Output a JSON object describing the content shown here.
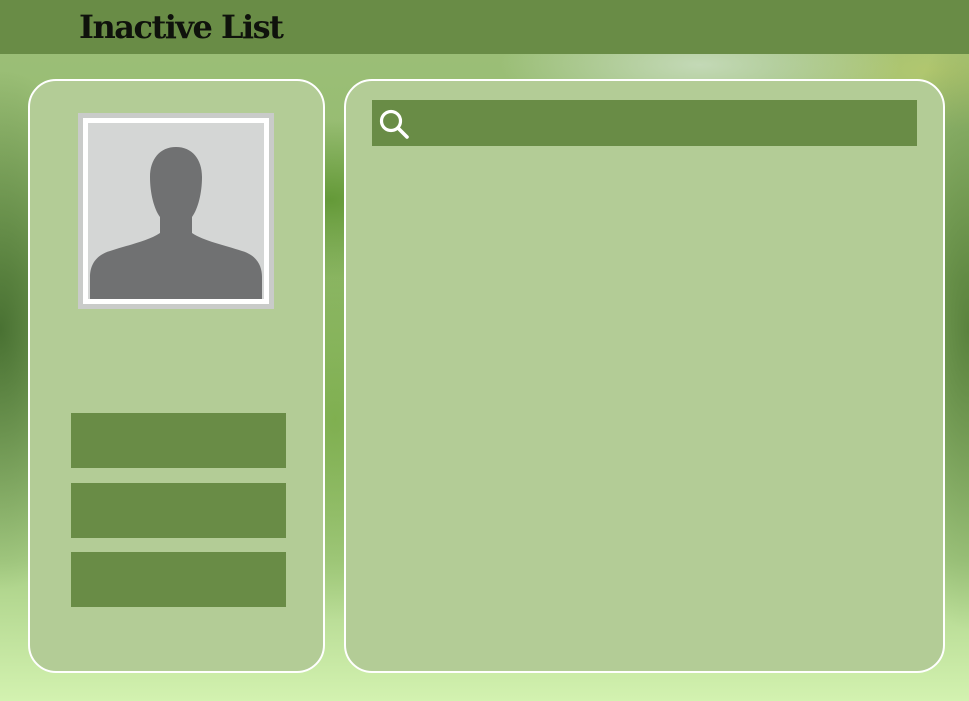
{
  "header": {
    "title": "Inactive List"
  },
  "profile": {
    "avatar_icon": "default-user-silhouette-icon"
  },
  "sidebar": {
    "buttons": [
      {
        "label": ""
      },
      {
        "label": ""
      },
      {
        "label": ""
      }
    ]
  },
  "search": {
    "icon": "search-icon",
    "value": "",
    "placeholder": ""
  },
  "colors": {
    "header_bar": "#698c46",
    "panel_fill": "#b3cc96",
    "button_fill": "#698c46",
    "avatar_silhouette": "#707172",
    "avatar_background": "#d4d6d5"
  }
}
